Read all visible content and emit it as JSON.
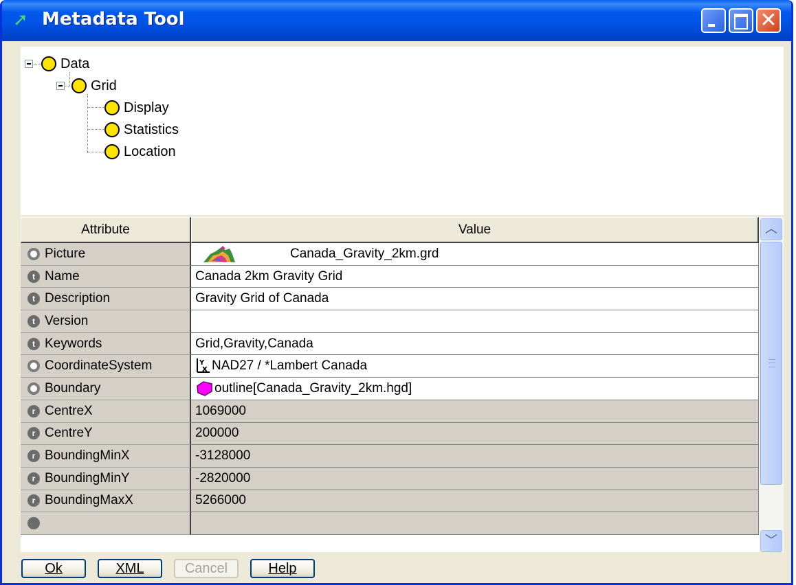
{
  "window": {
    "title": "Metadata Tool",
    "app_icon": "metadata-tool-icon",
    "close_glyph": "✕"
  },
  "tree": {
    "nodes": [
      {
        "label": "Data",
        "expanded": true
      },
      {
        "label": "Grid",
        "expanded": true
      },
      {
        "label": "Display"
      },
      {
        "label": "Statistics"
      },
      {
        "label": "Location"
      }
    ]
  },
  "grid": {
    "headers": {
      "attribute": "Attribute",
      "value": "Value"
    },
    "rows": [
      {
        "attribute": "Picture",
        "value": "Canada_Gravity_2km.grd",
        "type": "object"
      },
      {
        "attribute": "Name",
        "value": "Canada 2km Gravity Grid",
        "type": "text"
      },
      {
        "attribute": "Description",
        "value": "Gravity Grid of Canada",
        "type": "text"
      },
      {
        "attribute": "Version",
        "value": "",
        "type": "text"
      },
      {
        "attribute": "Keywords",
        "value": "Grid,Gravity,Canada",
        "type": "text"
      },
      {
        "attribute": "CoordinateSystem",
        "value": "NAD27 / *Lambert Canada",
        "type": "object"
      },
      {
        "attribute": "Boundary",
        "value": "outline[Canada_Gravity_2km.hgd]",
        "type": "object"
      },
      {
        "attribute": "CentreX",
        "value": "1069000",
        "type": "real"
      },
      {
        "attribute": "CentreY",
        "value": "200000",
        "type": "real"
      },
      {
        "attribute": "BoundingMinX",
        "value": "-3128000",
        "type": "real"
      },
      {
        "attribute": "BoundingMinY",
        "value": "-2820000",
        "type": "real"
      },
      {
        "attribute": "BoundingMaxX",
        "value": "5266000",
        "type": "real"
      }
    ]
  },
  "buttons": {
    "ok": "Ok",
    "xml": "XML",
    "cancel": "Cancel",
    "help": "Help"
  },
  "colors": {
    "titlebar": "#0054e3",
    "node_fill": "#ffe400",
    "boundary_icon": "#ff00ff",
    "readonly_cell": "#d4d0c8"
  }
}
